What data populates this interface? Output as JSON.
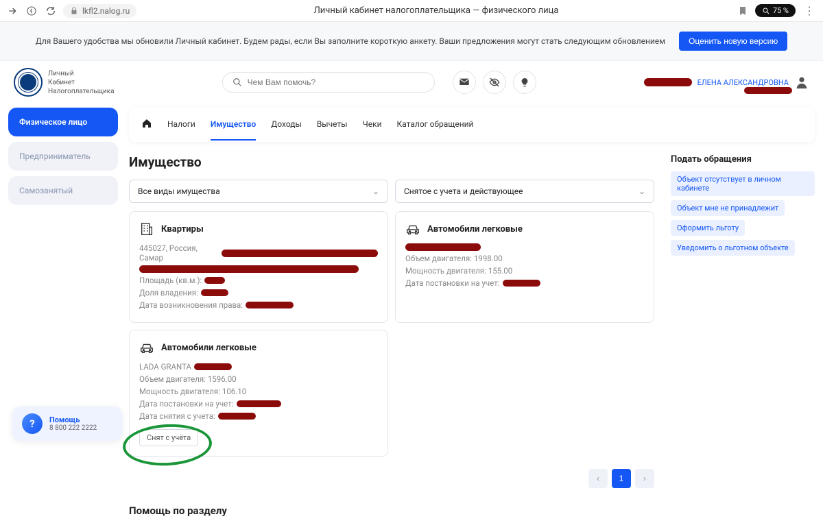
{
  "browser": {
    "url_host": "lkfl2.nalog.ru",
    "page_title": "Личный кабинет налогоплательщика — физического лица",
    "zoom": "75 %"
  },
  "banner": {
    "text": "Для Вашего удобства мы обновили Личный кабинет. Будем рады, если Вы заполните короткую анкету. Ваши предложения могут стать следующим обновлением",
    "button": "Оценить новую версию"
  },
  "header": {
    "logo_line1": "Личный",
    "logo_line2": "Кабинет",
    "logo_line3": "Налогоплательщика",
    "search_placeholder": "Чем Вам помочь?",
    "username": "ЕЛЕНА АЛЕКСАНДРОВНА"
  },
  "side_tabs": {
    "t1": "Физическое лицо",
    "t2": "Предприниматель",
    "t3": "Самозанятый"
  },
  "nav": {
    "n1": "Налоги",
    "n2": "Имущество",
    "n3": "Доходы",
    "n4": "Вычеты",
    "n5": "Чеки",
    "n6": "Каталог обращений"
  },
  "page": {
    "heading": "Имущество",
    "filter1": "Все виды имущества",
    "filter2": "Снятое с учета и действующее",
    "section_help": "Помощь по разделу"
  },
  "cards": {
    "apartment": {
      "title": "Квартиры",
      "address_prefix": "445027, Россия, Самар",
      "area_label": "Площадь (кв.м.):",
      "share_label": "Доля владения:",
      "date_label": "Дата возникновения права:"
    },
    "car1": {
      "title": "Автомобили легковые",
      "engine_vol": "Объем двигателя: 1998.00",
      "engine_pow": "Мощность двигателя: 155.00",
      "reg_date_label": "Дата постановки на учет:"
    },
    "car2": {
      "title": "Автомобили легковые",
      "model": "LADA GRANTA",
      "engine_vol": "Объем двигателя: 1596.00",
      "engine_pow": "Мощность двигателя: 106.10",
      "reg_date_label": "Дата постановки на учет:",
      "dereg_date_label": "Дата снятия с учета:",
      "badge": "Снят с учёта"
    }
  },
  "aside": {
    "heading": "Подать обращения",
    "l1": "Объект отсутствует в личном кабинете",
    "l2": "Объект мне не принадлежит",
    "l3": "Оформить льготу",
    "l4": "Уведомить о льготном объекте"
  },
  "pagination": {
    "current": "1"
  },
  "help": {
    "title": "Помощь",
    "phone": "8 800 222 2222"
  }
}
